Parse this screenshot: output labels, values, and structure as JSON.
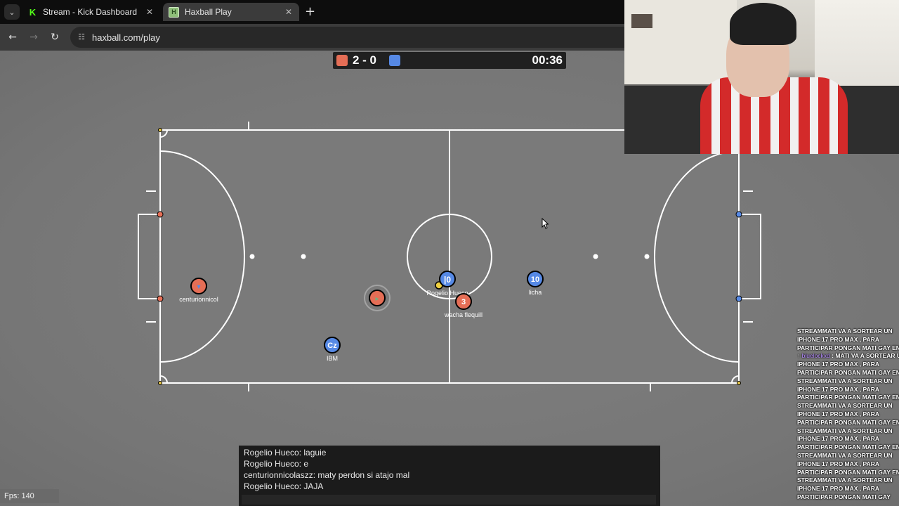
{
  "browser": {
    "tabs": [
      {
        "title": "Stream - Kick Dashboard",
        "icon": "kick-icon",
        "active": false
      },
      {
        "title": "Haxball Play",
        "icon": "haxball-icon",
        "active": true
      }
    ],
    "url": "haxball.com/play"
  },
  "scoreboard": {
    "score": "2 - 0",
    "time": "00:36",
    "colors": {
      "red": "#e56e56",
      "blue": "#5689e5"
    }
  },
  "players": [
    {
      "label": "centurionnicol",
      "avatar": "▾",
      "team": "red"
    },
    {
      "label": "",
      "avatar": "▸",
      "team": "red"
    },
    {
      "label": "Rogelio Hueco",
      "avatar": "|0",
      "team": "blue"
    },
    {
      "label": "wacha flequill",
      "avatar": "3",
      "team": "red"
    },
    {
      "label": "licha",
      "avatar": "10",
      "team": "blue"
    },
    {
      "label": "IBM",
      "avatar": "Cz",
      "team": "blue"
    }
  ],
  "chat": {
    "lines": [
      "Rogelio Hueco: laguie",
      "Rogelio Hueco: e",
      "centurionnicolaszz: maty perdon si atajo mal",
      "Rogelio Hueco: JAJA"
    ]
  },
  "fps": "Fps: 140",
  "stream_chat": {
    "lines": [
      "STREAMMATI VA A SORTEAR UN",
      "IPHONE 17 PRO MAX , PARA",
      "PARTICIPAR PONGAN MATI GAY EN",
      "",
      "MATI VA A SORTEAR UN",
      "IPHONE 17 PRO MAX , PARA",
      "PARTICIPAR PONGAN MATI GAY EN EL",
      "STREAMMATI VA A SORTEAR UN",
      "IPHONE 17 PRO MAX , PARA",
      "PARTICIPAR PONGAN MATI GAY EN EL",
      "STREAMMATI VA A SORTEAR UN",
      "IPHONE 17 PRO MAX , PARA",
      "PARTICIPAR PONGAN MATI GAY EN EL",
      "STREAMMATI VA A SORTEAR UN",
      "IPHONE 17 PRO MAX , PARA",
      "PARTICIPAR PONGAN MATI GAY EN EL",
      "STREAMMATI VA A SORTEAR UN",
      "IPHONE 17 PRO MAX , PARA",
      "PARTICIPAR PONGAN MATI GAY EN EL",
      "STREAMMATI VA A SORTEAR UN",
      "IPHONE 17 PRO MAX , PARA",
      "PARTICIPAR PONGAN MATI GAY"
    ],
    "username": "bluelockxd",
    "badge": "↑"
  }
}
